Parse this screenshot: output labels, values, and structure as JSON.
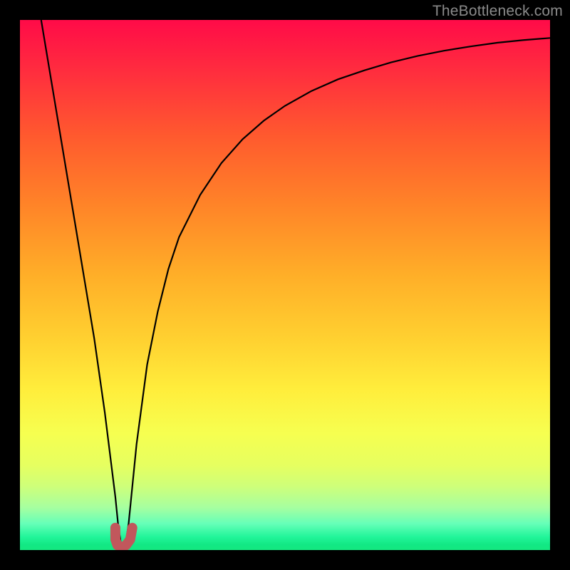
{
  "watermark": "TheBottleneck.com",
  "colors": {
    "frame": "#000000",
    "gradient_top": "#ff0b48",
    "gradient_bottom": "#14e880",
    "curve": "#000000",
    "marker": "#c1575c"
  },
  "chart_data": {
    "type": "line",
    "title": "",
    "xlabel": "",
    "ylabel": "",
    "xlim": [
      0,
      100
    ],
    "ylim": [
      0,
      100
    ],
    "curve": {
      "x": [
        4,
        6,
        8,
        10,
        12,
        14,
        16,
        17,
        18,
        18.5,
        19,
        19.5,
        20,
        20.5,
        21,
        22,
        24,
        26,
        28,
        30,
        34,
        38,
        42,
        46,
        50,
        55,
        60,
        65,
        70,
        75,
        80,
        85,
        90,
        95,
        100
      ],
      "y": [
        100,
        88,
        76,
        64,
        52,
        40,
        26,
        18,
        10,
        5,
        1.5,
        0.6,
        1.5,
        5,
        10,
        20,
        35,
        45,
        53,
        59,
        67,
        73,
        77.5,
        81,
        83.8,
        86.6,
        88.8,
        90.5,
        92,
        93.2,
        94.2,
        95,
        95.7,
        96.2,
        96.6
      ]
    },
    "marker": {
      "shape": "u",
      "x": [
        18.0,
        18.0,
        18.4,
        19.2,
        20.0,
        20.8,
        21.2,
        21.2
      ],
      "y": [
        4.2,
        2.0,
        0.9,
        0.5,
        0.9,
        2.0,
        4.2,
        4.2
      ]
    }
  }
}
